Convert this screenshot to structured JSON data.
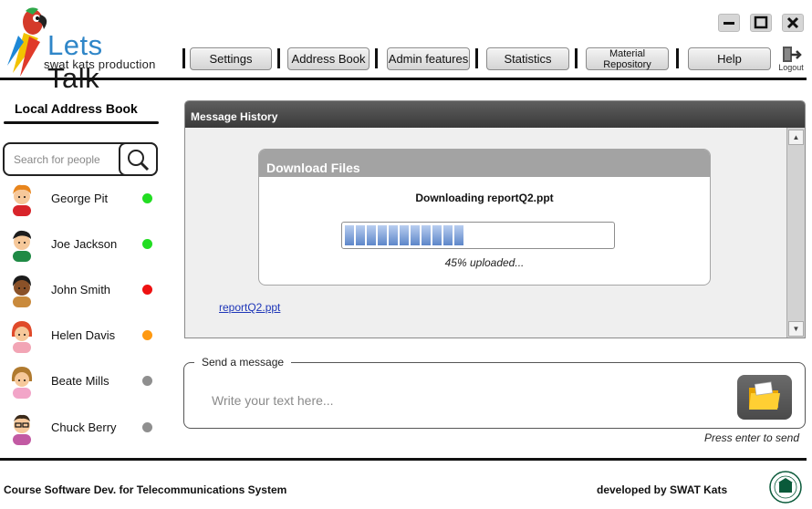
{
  "app": {
    "name_part1": "Lets",
    "name_part2": "Talk",
    "tagline": "swat kats production"
  },
  "window_controls": {
    "minimize_icon": "minimize-icon",
    "maximize_icon": "maximize-icon",
    "close_icon": "close-icon"
  },
  "nav": {
    "items": [
      {
        "label": "Settings"
      },
      {
        "label": "Address Book"
      },
      {
        "label": "Admin features"
      },
      {
        "label": "Statistics"
      },
      {
        "label": "Material Repository"
      },
      {
        "label": "Help"
      }
    ],
    "logout_label": "Logout"
  },
  "sidebar": {
    "title": "Local Address Book",
    "search_placeholder": "Search for people",
    "contacts": [
      {
        "name": "George Pit",
        "status": "online",
        "status_color": "#22dd22"
      },
      {
        "name": "Joe Jackson",
        "status": "online",
        "status_color": "#22dd22"
      },
      {
        "name": "John Smith",
        "status": "busy",
        "status_color": "#ee1111"
      },
      {
        "name": "Helen Davis",
        "status": "away",
        "status_color": "#ff9911"
      },
      {
        "name": "Beate Mills",
        "status": "offline",
        "status_color": "#8f8f8f"
      },
      {
        "name": "Chuck Berry",
        "status": "offline",
        "status_color": "#8f8f8f"
      }
    ]
  },
  "message_history": {
    "title": "Message History",
    "file_link": "reportQ2.ppt"
  },
  "download": {
    "title": "Download Files",
    "status_text": "Downloading reportQ2.ppt",
    "progress_percent": 45,
    "progress_text": "45% uploaded..."
  },
  "send": {
    "legend": "Send a message",
    "placeholder": "Write your text here...",
    "hint": "Press enter to send"
  },
  "footer": {
    "left": "Course Software Dev. for Telecommunications System",
    "right": "developed by SWAT Kats"
  },
  "colors": {
    "accent_blue": "#2f86c8",
    "header_dark": "#3a3a3a",
    "link": "#1e36b8"
  }
}
